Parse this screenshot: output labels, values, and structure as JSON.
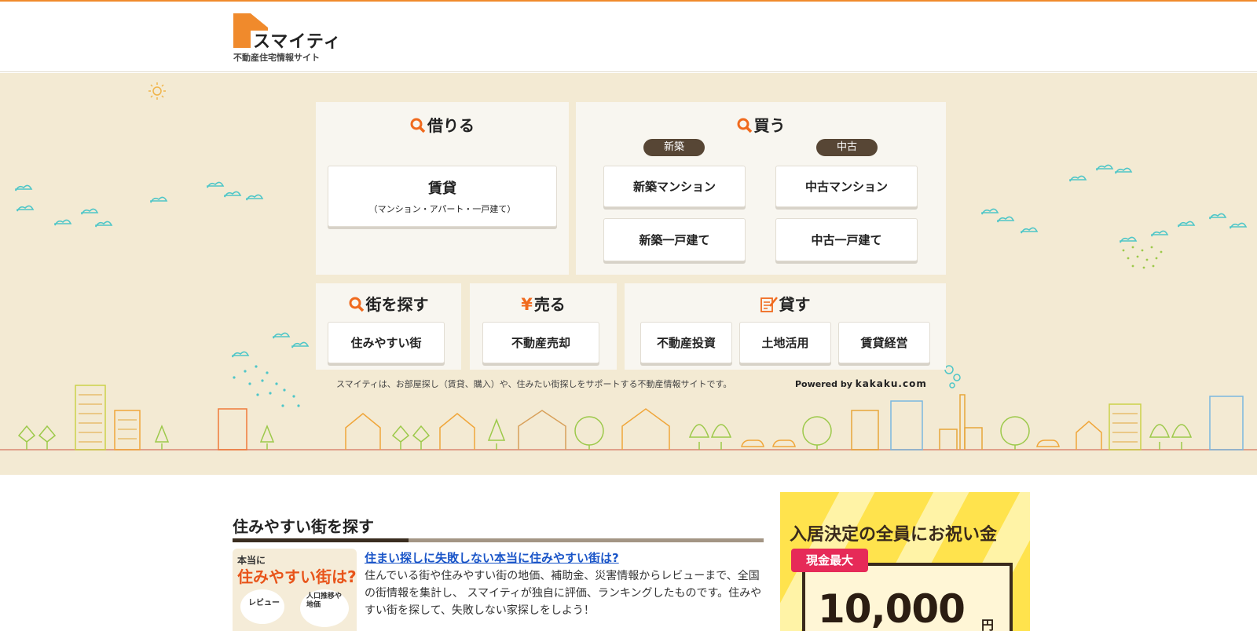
{
  "header": {
    "logo_name": "スマイティ",
    "logo_sub": "不動産住宅情報サイト"
  },
  "colors": {
    "accent": "#f08a2c",
    "hero_bg": "#f3ead3",
    "pill_bg": "#574635",
    "link": "#1a55c8"
  },
  "panels": {
    "rent": {
      "title": "借りる",
      "icon": "search-icon",
      "button_main": "賃貸",
      "button_sub": "（マンション・アパート・一戸建て）"
    },
    "buy": {
      "title": "買う",
      "icon": "search-icon",
      "new_label": "新築",
      "used_label": "中古",
      "new_mansion": "新築マンション",
      "new_house": "新築一戸建て",
      "used_mansion": "中古マンション",
      "used_house": "中古一戸建て"
    },
    "town": {
      "title": "街を探す",
      "icon": "search-icon",
      "button": "住みやすい街"
    },
    "sell": {
      "title": "売る",
      "icon": "yen-icon",
      "button": "不動産売却"
    },
    "lend": {
      "title": "貸す",
      "icon": "note-pencil-icon",
      "investment": "不動産投資",
      "land": "土地活用",
      "management": "賃貸経営"
    }
  },
  "hero": {
    "tagline": "スマイティは、お部屋探し（賃貸、購入）や、住みたい街探しをサポートする不動産情報サイトです。",
    "powered_by": "Powered by",
    "powered_brand": "kakaku.com"
  },
  "section": {
    "title": "住みやすい街を探す",
    "thumb_line1": "本当に",
    "thumb_line2": "住みやすい街は?",
    "thumb_review": "レビュー",
    "thumb_population": "人口推移や地価",
    "article_link": "住まい探しに失敗しない本当に住みやすい街は?",
    "article_text": "住んでいる街や住みやすい街の地価、補助金、災害情報からレビューまで、全国の街情報を集計し、 スマイティが独自に評価、ランキングしたものです。住みやすい街を探して、失敗しない家探しをしよう！"
  },
  "ad": {
    "headline": "入居決定の全員にお祝い金",
    "badge": "現金最大",
    "amount": "10,000",
    "unit": "円"
  }
}
